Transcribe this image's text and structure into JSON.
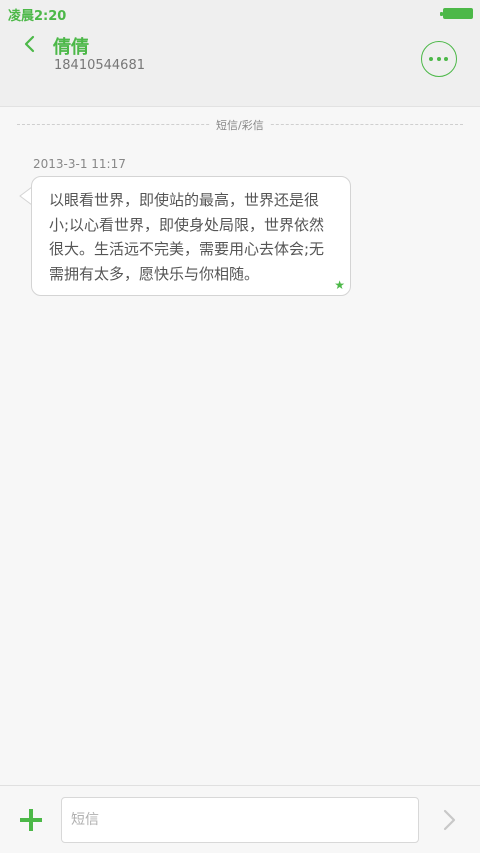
{
  "status_bar": {
    "time": "凌晨2:20",
    "battery_icon": "battery-full-icon",
    "accent_color": "#4cb848"
  },
  "header": {
    "back_icon": "chevron-left-icon",
    "contact_name": "倩倩",
    "contact_number": "18410544681",
    "more_icon": "more-dots-icon"
  },
  "conversation": {
    "section_label": "短信/彩信",
    "messages": [
      {
        "timestamp": "2013-3-1 11:17",
        "lines": [
          "以眼看世界，即使站的最高，世界还是很",
          "小;以心看世界，即使身处局限，世界依然",
          "很大。生活远不完美，需要用心去体会;无",
          "需拥有太多，愿快乐与你相随。"
        ],
        "starred": true,
        "star_icon": "star-icon"
      }
    ]
  },
  "composer": {
    "add_icon": "plus-icon",
    "input_value": "",
    "input_placeholder": "短信",
    "send_icon": "chevron-right-icon"
  }
}
